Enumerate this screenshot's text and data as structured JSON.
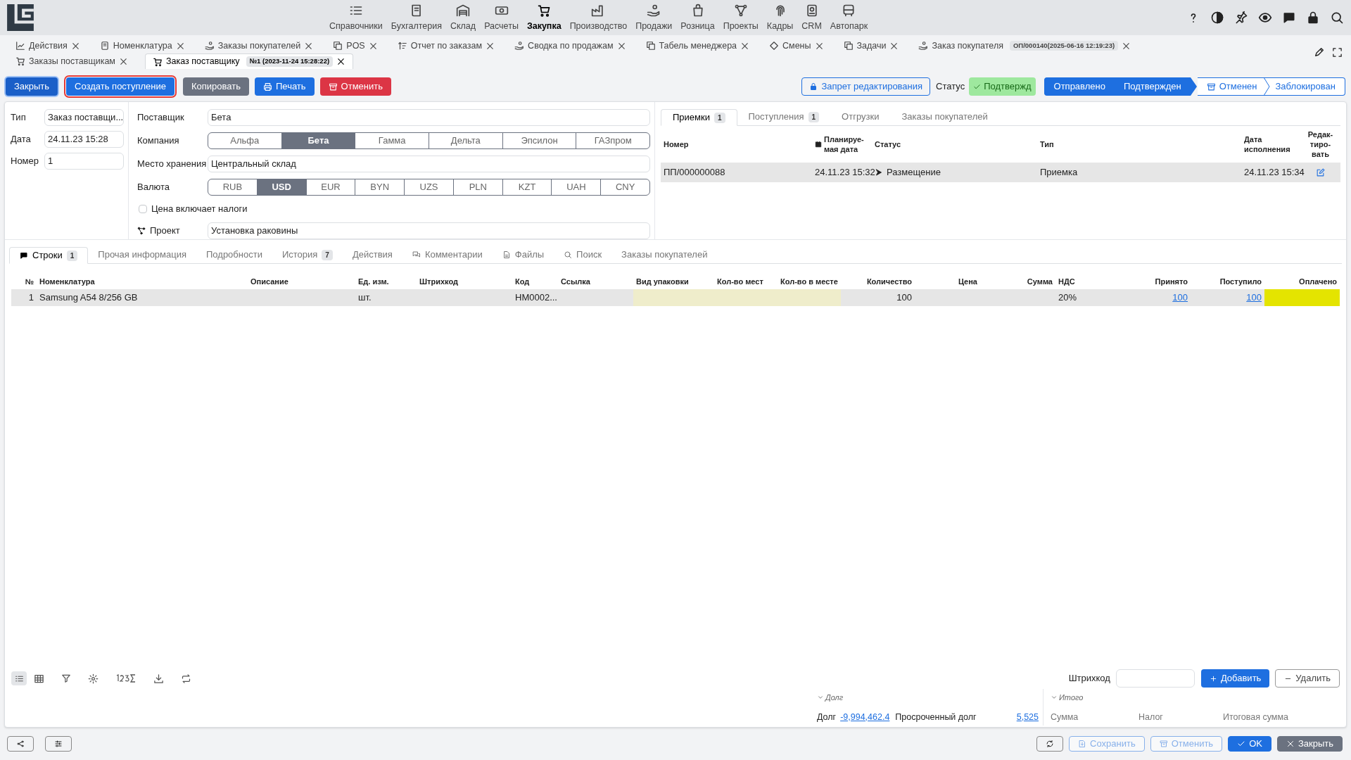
{
  "nav": {
    "items": [
      {
        "label": "Справочники",
        "selected": false
      },
      {
        "label": "Бухгалтерия",
        "selected": false
      },
      {
        "label": "Склад",
        "selected": false
      },
      {
        "label": "Расчеты",
        "selected": false
      },
      {
        "label": "Закупка",
        "selected": true
      },
      {
        "label": "Производство",
        "selected": false
      },
      {
        "label": "Продажи",
        "selected": false
      },
      {
        "label": "Розница",
        "selected": false
      },
      {
        "label": "Проекты",
        "selected": false
      },
      {
        "label": "Кадры",
        "selected": false
      },
      {
        "label": "CRM",
        "selected": false
      },
      {
        "label": "Автопарк",
        "selected": false
      }
    ]
  },
  "open_tabs": [
    {
      "label": "Действия",
      "selected": false
    },
    {
      "label": "Номенклатура",
      "selected": false
    },
    {
      "label": "Заказы покупателей",
      "selected": false
    },
    {
      "label": "POS",
      "selected": false
    },
    {
      "label": "Отчет по заказам",
      "selected": false
    },
    {
      "label": "Сводка по продажам",
      "selected": false
    },
    {
      "label": "Табель менеджера",
      "selected": false
    },
    {
      "label": "Смены",
      "selected": false
    },
    {
      "label": "Задачи",
      "selected": false
    },
    {
      "label": "Заказ покупателя",
      "badge": "ОП/000140(2025-06-16 12:19:23)",
      "selected": false
    },
    {
      "label": "Заказы поставщикам",
      "selected": false
    },
    {
      "label": "Заказ поставщику",
      "badge": "№1 (2023-11-24 15:28:22)",
      "selected": true
    }
  ],
  "toolbar": {
    "buttons": [
      {
        "label": "Закрыть",
        "kind": "dark"
      },
      {
        "label": "Создать поступление",
        "kind": "focused"
      },
      {
        "label": "Копировать",
        "kind": "gray"
      },
      {
        "label": "Печать",
        "kind": "print"
      },
      {
        "label": "Отменить",
        "kind": "danger"
      }
    ],
    "lock_button": "Запрет редактирования",
    "status_label": "Статус",
    "status": "Подтвержд",
    "stages": [
      {
        "label": "Отправлено",
        "done": true
      },
      {
        "label": "Подтвержден",
        "done": true
      },
      {
        "label": "Отменен",
        "done": false
      },
      {
        "label": "Заблокирован",
        "done": false
      }
    ]
  },
  "header_fields": [
    {
      "label": "Тип",
      "value": "Заказ поставщи..."
    },
    {
      "label": "Дата",
      "value": "24.11.23 15:28"
    },
    {
      "label": "Номер",
      "value": "1"
    }
  ],
  "form": {
    "supplier": {
      "label": "Поставщик",
      "value": "Бета"
    },
    "company": {
      "label": "Компания",
      "options": [
        {
          "label": "Альфа",
          "selected": false
        },
        {
          "label": "Бета",
          "selected": true
        },
        {
          "label": "Гамма",
          "selected": false
        },
        {
          "label": "Дельта",
          "selected": false
        },
        {
          "label": "Эпсилон",
          "selected": false
        },
        {
          "label": "ГАЗпром",
          "selected": false
        }
      ]
    },
    "storage": {
      "label": "Место хранения",
      "value": "Центральный склад"
    },
    "currency": {
      "label": "Валюта",
      "options": [
        {
          "label": "RUB",
          "selected": false
        },
        {
          "label": "USD",
          "selected": true
        },
        {
          "label": "EUR",
          "selected": false
        },
        {
          "label": "BYN",
          "selected": false
        },
        {
          "label": "UZS",
          "selected": false
        },
        {
          "label": "PLN",
          "selected": false
        },
        {
          "label": "KZT",
          "selected": false
        },
        {
          "label": "UAH",
          "selected": false
        },
        {
          "label": "CNY",
          "selected": false
        }
      ]
    },
    "price_includes_tax": {
      "label": "Цена включает налоги",
      "checked": false
    },
    "project": {
      "label": "Проект",
      "value": "Установка раковины"
    }
  },
  "linked_tabs": [
    {
      "label": "Приемки",
      "badge": "1",
      "selected": true
    },
    {
      "label": "Поступления",
      "badge": "1",
      "selected": false
    },
    {
      "label": "Отгрузки",
      "selected": false
    },
    {
      "label": "Заказы покупателей",
      "selected": false
    }
  ],
  "receipts_table": {
    "columns": [
      "Номер",
      "Планируе-мая дата",
      "Статус",
      "Тип",
      "Дата исполнения",
      "Редак-тиро-вать"
    ],
    "rows": [
      {
        "cells": [
          "ПП/000000088",
          "24.11.23 15:32",
          "Размещение",
          "Приемка",
          "24.11.23 15:34"
        ],
        "selected": true
      }
    ]
  },
  "line_tabs": [
    {
      "label": "Строки",
      "badge": "1",
      "selected": true
    },
    {
      "label": "Прочая информация",
      "selected": false
    },
    {
      "label": "Подробности",
      "selected": false
    },
    {
      "label": "История",
      "badge": "7",
      "selected": false
    },
    {
      "label": "Действия",
      "selected": false
    },
    {
      "label": "Комментарии",
      "selected": false
    },
    {
      "label": "Файлы",
      "selected": false
    },
    {
      "label": "Поиск",
      "selected": false
    },
    {
      "label": "Заказы покупателей",
      "selected": false
    }
  ],
  "lines_table": {
    "columns": [
      {
        "label": "№",
        "kind": "number"
      },
      {
        "label": "Номенклатура",
        "kind": "text"
      },
      {
        "label": "Описание",
        "kind": "text"
      },
      {
        "label": "Ед. изм.",
        "kind": "text"
      },
      {
        "label": "Штрихкод",
        "kind": "text"
      },
      {
        "label": "Код",
        "kind": "text"
      },
      {
        "label": "Ссылка",
        "kind": "text"
      },
      {
        "label": "Вид упаковки",
        "kind": "text",
        "color": "#efedcb"
      },
      {
        "label": "Кол-во мест",
        "kind": "text",
        "color": "#efedcb"
      },
      {
        "label": "Кол-во в месте",
        "kind": "text",
        "color": "#efedcb"
      },
      {
        "label": "Количество",
        "kind": "number"
      },
      {
        "label": "Цена",
        "kind": "number"
      },
      {
        "label": "Сумма",
        "kind": "number"
      },
      {
        "label": "НДС",
        "kind": "text"
      },
      {
        "label": "Принято",
        "kind": "link"
      },
      {
        "label": "Поступило",
        "kind": "link"
      },
      {
        "label": "Оплачено",
        "kind": "number",
        "color": "#e4e400"
      }
    ],
    "rows": [
      {
        "cells": [
          "1",
          "Samsung A54 8/256 GB",
          null,
          "шт.",
          null,
          "НМ0002...",
          null,
          null,
          null,
          null,
          "100",
          null,
          null,
          "20%",
          "100",
          "100",
          null
        ],
        "selected": true
      }
    ]
  },
  "bottom_bar": {
    "barcode_label": "Штрихкод",
    "add_button": "Добавить",
    "delete_button": "Удалить"
  },
  "debt": {
    "title": "Долг",
    "label": "Долг",
    "value": "-9,994,462.4",
    "overdue_label": "Просроченный долг",
    "overdue_value": "5,525"
  },
  "totals": {
    "title": "Итого",
    "columns": [
      "Сумма",
      "Налог",
      "Итоговая сумма"
    ]
  },
  "footer": {
    "buttons": [
      {
        "label": "Сохранить",
        "kind": "outline",
        "disabled": true
      },
      {
        "label": "Отменить",
        "kind": "outline",
        "disabled": true
      },
      {
        "label": "OK",
        "kind": "primary",
        "disabled": false
      },
      {
        "label": "Закрыть",
        "kind": "gray",
        "disabled": false
      }
    ]
  }
}
